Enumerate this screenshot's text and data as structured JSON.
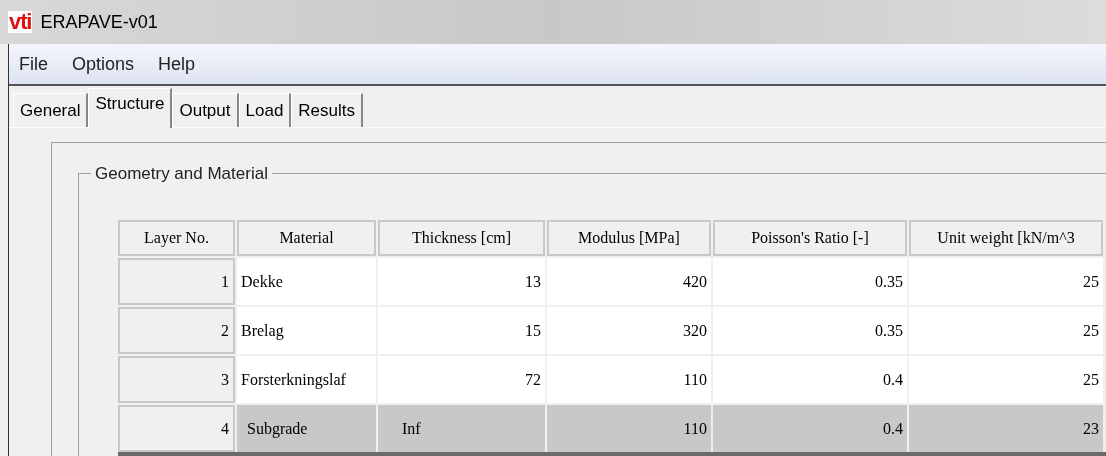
{
  "window": {
    "logo": "vti",
    "title": "ERAPAVE-v01"
  },
  "menu": [
    "File",
    "Options",
    "Help"
  ],
  "tabs": [
    {
      "label": "General",
      "selected": false
    },
    {
      "label": "Structure",
      "selected": true
    },
    {
      "label": "Output",
      "selected": false
    },
    {
      "label": "Load",
      "selected": false
    },
    {
      "label": "Results",
      "selected": false
    }
  ],
  "group": {
    "title": "Geometry and Material"
  },
  "table": {
    "columns": [
      "Layer No.",
      "Material",
      "Thickness [cm]",
      "Modulus [MPa]",
      "Poisson's Ratio [-]",
      "Unit weight [kN/m^3"
    ],
    "rows": [
      {
        "cells": [
          "1",
          "Dekke",
          "13",
          "420",
          "0.35",
          "25"
        ],
        "selected": false
      },
      {
        "cells": [
          "2",
          "Brelag",
          "15",
          "320",
          "0.35",
          "25"
        ],
        "selected": false
      },
      {
        "cells": [
          "3",
          "Forsterkningslaf",
          "72",
          "110",
          "0.4",
          "25"
        ],
        "selected": false
      },
      {
        "cells": [
          "4",
          "Subgrade",
          "Inf",
          "110",
          "0.4",
          "23"
        ],
        "selected": true
      }
    ]
  }
}
